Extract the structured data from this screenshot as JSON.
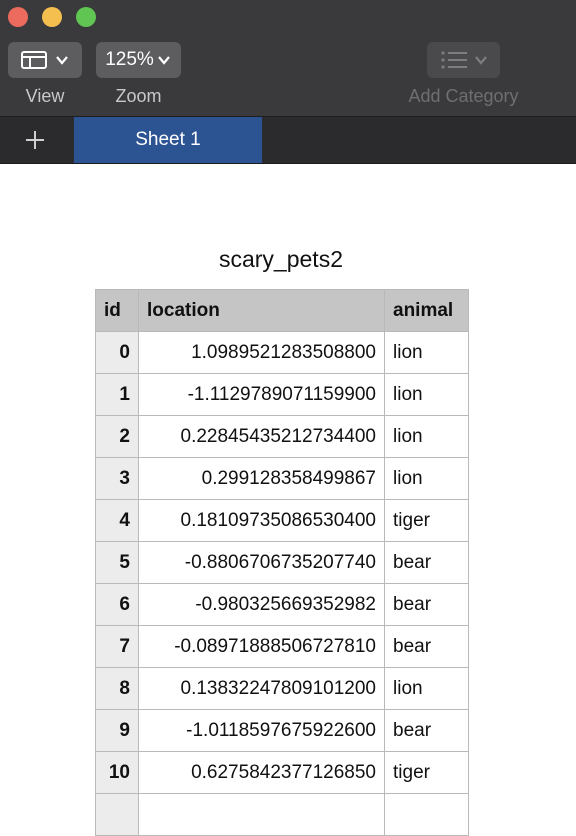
{
  "toolbar": {
    "view_label": "View",
    "zoom_value": "125%",
    "zoom_label": "Zoom",
    "add_category_label": "Add Category"
  },
  "tabs": {
    "active": "Sheet 1"
  },
  "table": {
    "title": "scary_pets2",
    "columns": [
      "id",
      "location",
      "animal"
    ],
    "rows": [
      {
        "id": "0",
        "location": "1.0989521283508800",
        "animal": "lion"
      },
      {
        "id": "1",
        "location": "-1.1129789071159900",
        "animal": "lion"
      },
      {
        "id": "2",
        "location": "0.22845435212734400",
        "animal": "lion"
      },
      {
        "id": "3",
        "location": "0.299128358499867",
        "animal": "lion"
      },
      {
        "id": "4",
        "location": "0.18109735086530400",
        "animal": "tiger"
      },
      {
        "id": "5",
        "location": "-0.8806706735207740",
        "animal": "bear"
      },
      {
        "id": "6",
        "location": "-0.980325669352982",
        "animal": "bear"
      },
      {
        "id": "7",
        "location": "-0.08971888506727810",
        "animal": "bear"
      },
      {
        "id": "8",
        "location": "0.13832247809101200",
        "animal": "lion"
      },
      {
        "id": "9",
        "location": "-1.0118597675922600",
        "animal": "bear"
      },
      {
        "id": "10",
        "location": "0.6275842377126850",
        "animal": "tiger"
      }
    ]
  }
}
